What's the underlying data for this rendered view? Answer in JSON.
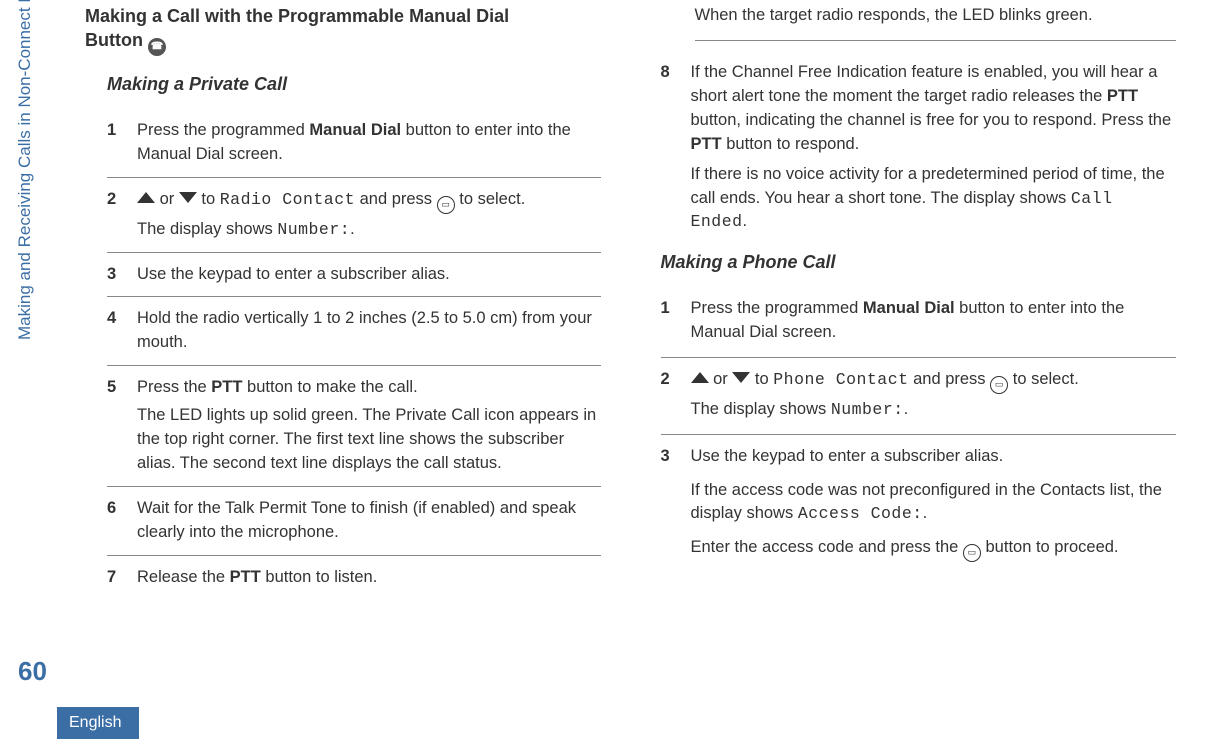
{
  "sidebar": {
    "section_label": "Making and Receiving Calls in Non-Connect Plus Mode",
    "page_number": "60",
    "language": "English"
  },
  "left": {
    "title_line1": "Making a Call with the Programmable Manual Dial",
    "title_line2": "Button ",
    "subtitle": "Making a Private Call",
    "step1_a": "Press the programmed ",
    "step1_b": "Manual Dial",
    "step1_c": " button to enter into the Manual Dial screen.",
    "step2_or": " or ",
    "step2_to": " to ",
    "step2_rc": "Radio Contact",
    "step2_press": " and press ",
    "step2_sel": " to select.",
    "step2_disp": "The display shows ",
    "step2_num": "Number:",
    "step3": "Use the keypad to enter a subscriber alias.",
    "step4": "Hold the radio vertically 1 to 2 inches (2.5 to 5.0 cm) from your mouth.",
    "step5_a": "Press the ",
    "step5_b": "PTT",
    "step5_c": " button to make the call.",
    "step5_d": "The LED lights up solid green. The Private Call icon appears in the top right corner. The first text line shows the subscriber alias. The second text line displays the call status.",
    "step6": "Wait for the Talk Permit Tone to finish (if enabled) and speak clearly into the microphone.",
    "step7_a": "Release the ",
    "step7_b": "PTT",
    "step7_c": " button to listen."
  },
  "right": {
    "top_para": "When the target radio responds, the LED blinks green.",
    "step8_a": "If the Channel Free Indication feature is enabled, you will hear a short alert tone the moment the target radio releases the ",
    "step8_b": "PTT",
    "step8_c": " button, indicating the channel is free for you to respond. Press the ",
    "step8_d": "PTT",
    "step8_e": " button to respond.",
    "step8_p2a": "If there is no voice activity for a predetermined period of time, the call ends. You hear a short tone. The display shows ",
    "step8_p2b": "Call Ended",
    "subtitle2": "Making a Phone Call",
    "p_step1_a": "Press the programmed ",
    "p_step1_b": "Manual Dial",
    "p_step1_c": " button to enter into the Manual Dial screen.",
    "p_step2_or": " or ",
    "p_step2_to": " to ",
    "p_step2_pc": "Phone Contact",
    "p_step2_press": " and press ",
    "p_step2_sel": " to select.",
    "p_step2_disp": "The display shows ",
    "p_step2_num": "Number:",
    "p_step3_a": "Use the keypad to enter a subscriber alias.",
    "p_step3_b1": "If the access code was not preconfigured in the Contacts list, the display shows ",
    "p_step3_b2": "Access Code:",
    "p_step3_c1": "Enter the access code and press the ",
    "p_step3_c2": " button to proceed."
  },
  "nums": {
    "n1": "1",
    "n2": "2",
    "n3": "3",
    "n4": "4",
    "n5": "5",
    "n6": "6",
    "n7": "7",
    "n8": "8"
  }
}
